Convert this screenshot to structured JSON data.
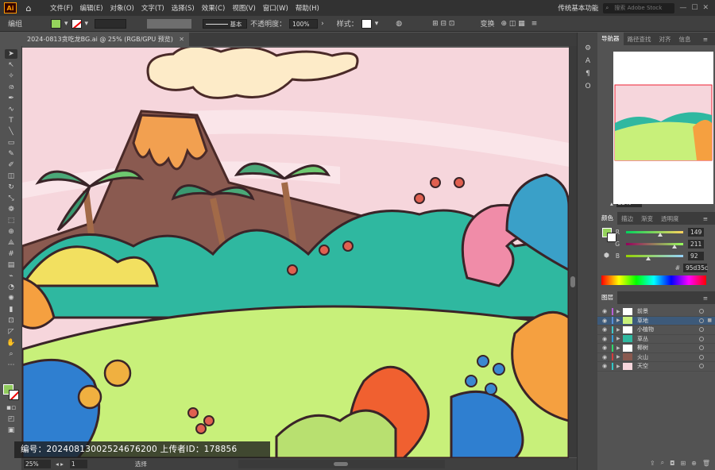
{
  "menubar": {
    "items": [
      "文件(F)",
      "编辑(E)",
      "对象(O)",
      "文字(T)",
      "选择(S)",
      "效果(C)",
      "视图(V)",
      "窗口(W)",
      "帮助(H)"
    ],
    "workspace": "传统基本功能",
    "search_placeholder": "搜索 Adobe Stock"
  },
  "control": {
    "label": "编组",
    "stroke_style": "基本",
    "opacity_label": "不透明度：",
    "opacity_value": "100%",
    "style_label": "样式：",
    "transform_label": "变换"
  },
  "document": {
    "tab_title": "2024-0813贪吃龙BG.ai @ 25% (RGB/GPU 预览)"
  },
  "status": {
    "zoom": "25%",
    "artboard": "1",
    "tool": "选择"
  },
  "navigator": {
    "tabs": [
      "导航器",
      "路径查找",
      "对齐",
      "信息"
    ],
    "zoom": "25%"
  },
  "color": {
    "tabs": [
      "颜色",
      "描边",
      "渐变",
      "透明度"
    ],
    "r": 149,
    "g": 211,
    "b": 92,
    "hex": "95d35c",
    "fill_color": "#95d35c"
  },
  "layers": {
    "tab": "图层",
    "items": [
      {
        "name": "前景",
        "color": "#b85fd6",
        "selected": false
      },
      {
        "name": "草地",
        "color": "#5a8fd6",
        "selected": true
      },
      {
        "name": "小植物",
        "color": "#3fc8c8",
        "selected": false
      },
      {
        "name": "草丛",
        "color": "#2f9bd6",
        "selected": false
      },
      {
        "name": "椰树",
        "color": "#2fd66a",
        "selected": false
      },
      {
        "name": "火山",
        "color": "#d63b3b",
        "selected": false
      },
      {
        "name": "天空",
        "color": "#2fc8c8",
        "selected": false
      }
    ]
  },
  "watermark": "编号：20240813002524676200  上传者ID：178856"
}
